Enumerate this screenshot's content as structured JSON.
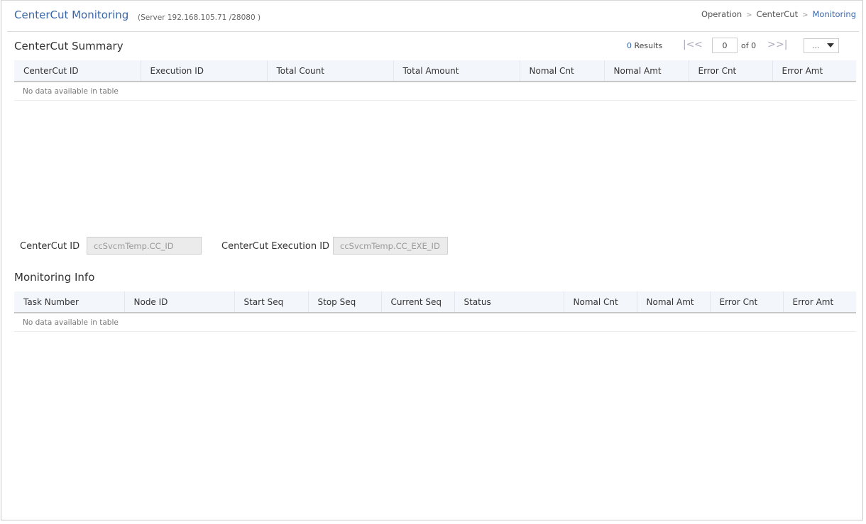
{
  "header": {
    "title": "CenterCut Monitoring",
    "server": "(Server 192.168.105.71 /28080 )",
    "breadcrumb": [
      "Operation",
      "CenterCut",
      "Monitoring"
    ],
    "breadcrumb_separator": ">"
  },
  "summary": {
    "title": "CenterCut Summary",
    "pager": {
      "results_count": "0",
      "results_label": "Results",
      "first_icon": "first-page-icon",
      "prev_icon": "prev-page-icon",
      "next_icon": "next-page-icon",
      "last_icon": "last-page-icon",
      "first_glyph": "|<",
      "prev_glyph": "<",
      "next_glyph": ">",
      "last_glyph": ">|",
      "page_value": "0",
      "of_label": "of 0",
      "page_size_value": "..."
    },
    "columns": [
      "CenterCut ID",
      "Execution ID",
      "Total Count",
      "Total Amount",
      "Nomal Cnt",
      "Nomal Amt",
      "Error Cnt",
      "Error Amt"
    ],
    "empty_message": "No data available in table"
  },
  "filters": {
    "centercut_id_label": "CenterCut ID",
    "centercut_id_value": "ccSvcmTemp.CC_ID",
    "execution_id_label": "CenterCut Execution ID",
    "execution_id_value": "ccSvcmTemp.CC_EXE_ID"
  },
  "monitoring": {
    "title": "Monitoring Info",
    "columns": [
      "Task Number",
      "Node ID",
      "Start Seq",
      "Stop Seq",
      "Current Seq",
      "Status",
      "Nomal Cnt",
      "Nomal Amt",
      "Error Cnt",
      "Error Amt"
    ],
    "empty_message": "No data available in table"
  },
  "colors": {
    "accent": "#3a66a8",
    "header_bg": "#f3f6fb",
    "readonly_input_bg": "#ebebeb"
  }
}
